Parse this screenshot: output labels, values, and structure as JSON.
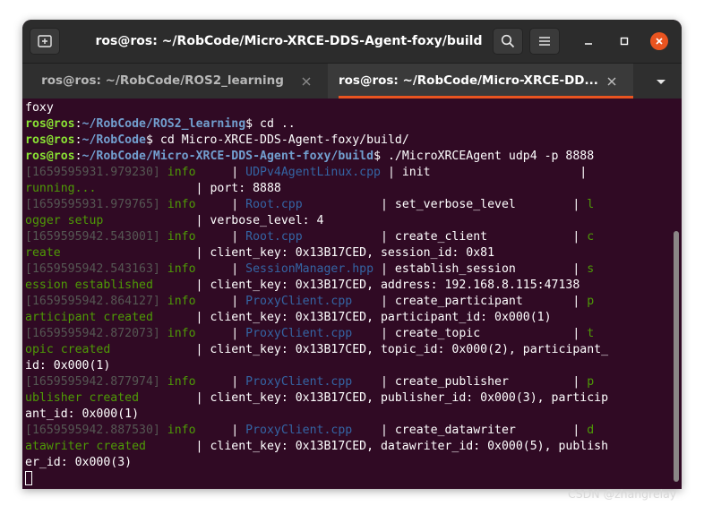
{
  "window": {
    "title": "ros@ros: ~/RobCode/Micro-XRCE-DDS-Agent-foxy/build",
    "new_tab_icon": "new-tab-icon",
    "search_icon": "search-icon",
    "menu_icon": "hamburger-menu-icon",
    "minimize_icon": "minimize-icon",
    "maximize_icon": "maximize-icon",
    "close_icon": "close-icon"
  },
  "tabs": [
    {
      "label": "ros@ros: ~/RobCode/ROS2_learning",
      "active": false
    },
    {
      "label": "ros@ros: ~/RobCode/Micro-XRCE-DD...",
      "active": true
    }
  ],
  "colors": {
    "terminal_bg": "#300a24",
    "accent": "#e95420",
    "prompt_user": "#8ae234",
    "prompt_path": "#729fcf",
    "log_time": "#555753",
    "log_level": "#4e9a06",
    "log_file": "#3465a4"
  },
  "terminal": {
    "lines": [
      [
        {
          "t": "foxy",
          "c": "white"
        }
      ],
      [
        {
          "t": "ros@ros",
          "c": "user"
        },
        {
          "t": ":",
          "c": "white"
        },
        {
          "t": "~/RobCode/ROS2_learning",
          "c": "path"
        },
        {
          "t": "$ cd ..",
          "c": "white"
        }
      ],
      [
        {
          "t": "ros@ros",
          "c": "user"
        },
        {
          "t": ":",
          "c": "white"
        },
        {
          "t": "~/RobCode",
          "c": "path"
        },
        {
          "t": "$ cd Micro-XRCE-DDS-Agent-foxy/build/",
          "c": "white"
        }
      ],
      [
        {
          "t": "ros@ros",
          "c": "user"
        },
        {
          "t": ":",
          "c": "white"
        },
        {
          "t": "~/RobCode/Micro-XRCE-DDS-Agent-foxy/build",
          "c": "path"
        },
        {
          "t": "$ ./MicroXRCEAgent udp4 -p 8888",
          "c": "white"
        }
      ],
      [
        {
          "t": "[1659595931.979230] ",
          "c": "grey"
        },
        {
          "t": "info",
          "c": "green"
        },
        {
          "t": "     | ",
          "c": "white"
        },
        {
          "t": "UDPv4AgentLinux.cpp",
          "c": "blue"
        },
        {
          "t": " | init                     |",
          "c": "white"
        }
      ],
      [
        {
          "t": "running...",
          "c": "green"
        },
        {
          "t": "              | port: 8888",
          "c": "white"
        }
      ],
      [
        {
          "t": "[1659595931.979765] ",
          "c": "grey"
        },
        {
          "t": "info",
          "c": "green"
        },
        {
          "t": "     | ",
          "c": "white"
        },
        {
          "t": "Root.cpp",
          "c": "blue"
        },
        {
          "t": "           | set_verbose_level        | ",
          "c": "white"
        },
        {
          "t": "l",
          "c": "green"
        }
      ],
      [
        {
          "t": "ogger setup",
          "c": "green"
        },
        {
          "t": "             | verbose_level: 4",
          "c": "white"
        }
      ],
      [
        {
          "t": "[1659595942.543001] ",
          "c": "grey"
        },
        {
          "t": "info",
          "c": "green"
        },
        {
          "t": "     | ",
          "c": "white"
        },
        {
          "t": "Root.cpp",
          "c": "blue"
        },
        {
          "t": "           | create_client            | ",
          "c": "white"
        },
        {
          "t": "c",
          "c": "green"
        }
      ],
      [
        {
          "t": "reate",
          "c": "green"
        },
        {
          "t": "                   | client_key: 0x13B17CED, session_id: 0x81",
          "c": "white"
        }
      ],
      [
        {
          "t": "[1659595942.543163] ",
          "c": "grey"
        },
        {
          "t": "info",
          "c": "green"
        },
        {
          "t": "     | ",
          "c": "white"
        },
        {
          "t": "SessionManager.hpp",
          "c": "blue"
        },
        {
          "t": " | establish_session        | ",
          "c": "white"
        },
        {
          "t": "s",
          "c": "green"
        }
      ],
      [
        {
          "t": "ession established",
          "c": "green"
        },
        {
          "t": "      | client_key: 0x13B17CED, address: 192.168.8.115:47138",
          "c": "white"
        }
      ],
      [
        {
          "t": "[1659595942.864127] ",
          "c": "grey"
        },
        {
          "t": "info",
          "c": "green"
        },
        {
          "t": "     | ",
          "c": "white"
        },
        {
          "t": "ProxyClient.cpp",
          "c": "blue"
        },
        {
          "t": "    | create_participant       | ",
          "c": "white"
        },
        {
          "t": "p",
          "c": "green"
        }
      ],
      [
        {
          "t": "articipant created",
          "c": "green"
        },
        {
          "t": "      | client_key: 0x13B17CED, participant_id: 0x000(1)",
          "c": "white"
        }
      ],
      [
        {
          "t": "[1659595942.872073] ",
          "c": "grey"
        },
        {
          "t": "info",
          "c": "green"
        },
        {
          "t": "     | ",
          "c": "white"
        },
        {
          "t": "ProxyClient.cpp",
          "c": "blue"
        },
        {
          "t": "    | create_topic             | ",
          "c": "white"
        },
        {
          "t": "t",
          "c": "green"
        }
      ],
      [
        {
          "t": "opic created",
          "c": "green"
        },
        {
          "t": "            | client_key: 0x13B17CED, topic_id: 0x000(2), participant_",
          "c": "white"
        }
      ],
      [
        {
          "t": "id: 0x000(1)",
          "c": "white"
        }
      ],
      [
        {
          "t": "[1659595942.877974] ",
          "c": "grey"
        },
        {
          "t": "info",
          "c": "green"
        },
        {
          "t": "     | ",
          "c": "white"
        },
        {
          "t": "ProxyClient.cpp",
          "c": "blue"
        },
        {
          "t": "    | create_publisher         | ",
          "c": "white"
        },
        {
          "t": "p",
          "c": "green"
        }
      ],
      [
        {
          "t": "ublisher created",
          "c": "green"
        },
        {
          "t": "        | client_key: 0x13B17CED, publisher_id: 0x000(3), particip",
          "c": "white"
        }
      ],
      [
        {
          "t": "ant_id: 0x000(1)",
          "c": "white"
        }
      ],
      [
        {
          "t": "[1659595942.887530] ",
          "c": "grey"
        },
        {
          "t": "info",
          "c": "green"
        },
        {
          "t": "     | ",
          "c": "white"
        },
        {
          "t": "ProxyClient.cpp",
          "c": "blue"
        },
        {
          "t": "    | create_datawriter        | ",
          "c": "white"
        },
        {
          "t": "d",
          "c": "green"
        }
      ],
      [
        {
          "t": "atawriter created",
          "c": "green"
        },
        {
          "t": "       | client_key: 0x13B17CED, datawriter_id: 0x000(5), publish",
          "c": "white"
        }
      ],
      [
        {
          "t": "er_id: 0x000(3)",
          "c": "white"
        }
      ]
    ]
  },
  "watermark": "CSDN @zhangrelay"
}
